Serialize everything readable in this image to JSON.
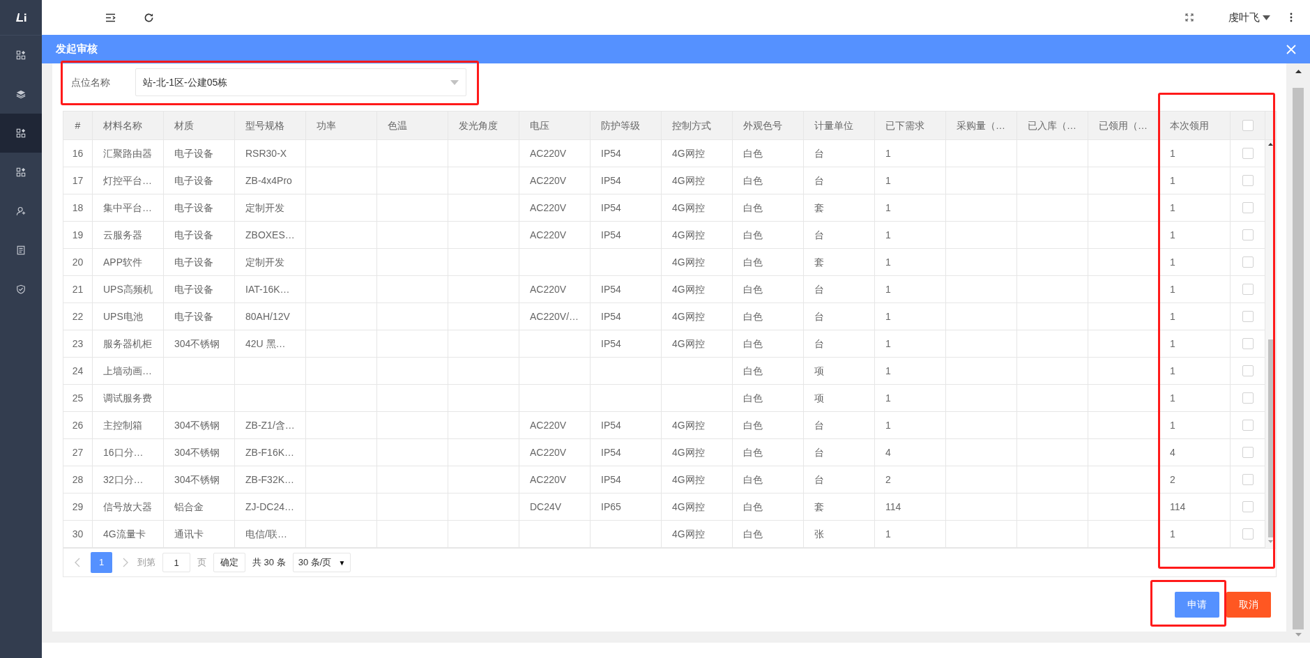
{
  "sidebar": {
    "items": [
      {
        "selected": false
      },
      {
        "selected": false
      },
      {
        "selected": true
      },
      {
        "selected": false
      },
      {
        "selected": false
      },
      {
        "selected": false
      },
      {
        "selected": false
      }
    ]
  },
  "topbar": {
    "user_name": "虔叶飞"
  },
  "dialog": {
    "title": "发起审核"
  },
  "form": {
    "label": "点位名称",
    "value": "站-北-1区-公建05栋"
  },
  "table": {
    "columns": [
      "#",
      "材料名称",
      "材质",
      "型号规格",
      "功率",
      "色温",
      "发光角度",
      "电压",
      "防护等级",
      "控制方式",
      "外观色号",
      "计量单位",
      "已下需求",
      "采购量（…",
      "已入库（…",
      "已领用（…",
      "本次领用"
    ],
    "header_checkbox": {
      "checked": false
    },
    "rows": [
      {
        "cells": [
          "16",
          "汇聚路由器",
          "电子设备",
          "RSR30-X",
          null,
          null,
          null,
          "AC220V",
          "IP54",
          "4G网控",
          "白色",
          "台",
          "1",
          null,
          null,
          null,
          "1"
        ],
        "checked": false
      },
      {
        "cells": [
          "17",
          "灯控平台…",
          "电子设备",
          "ZB-4x4Pro",
          null,
          null,
          null,
          "AC220V",
          "IP54",
          "4G网控",
          "白色",
          "台",
          "1",
          null,
          null,
          null,
          "1"
        ],
        "checked": false
      },
      {
        "cells": [
          "18",
          "集中平台…",
          "电子设备",
          "定制开发",
          null,
          null,
          null,
          "AC220V",
          "IP54",
          "4G网控",
          "白色",
          "套",
          "1",
          null,
          null,
          null,
          "1"
        ],
        "checked": false
      },
      {
        "cells": [
          "19",
          "云服务器",
          "电子设备",
          "ZBOXES…",
          null,
          null,
          null,
          "AC220V",
          "IP54",
          "4G网控",
          "白色",
          "台",
          "1",
          null,
          null,
          null,
          "1"
        ],
        "checked": false
      },
      {
        "cells": [
          "20",
          "APP软件",
          "电子设备",
          "定制开发",
          null,
          null,
          null,
          null,
          null,
          "4G网控",
          "白色",
          "套",
          "1",
          null,
          null,
          null,
          "1"
        ],
        "checked": false
      },
      {
        "cells": [
          "21",
          "UPS高频机",
          "电子设备",
          "IAT-16K…",
          null,
          null,
          null,
          "AC220V",
          "IP54",
          "4G网控",
          "白色",
          "台",
          "1",
          null,
          null,
          null,
          "1"
        ],
        "checked": false
      },
      {
        "cells": [
          "22",
          "UPS电池",
          "电子设备",
          "80AH/12V",
          null,
          null,
          null,
          "AC220V/…",
          "IP54",
          "4G网控",
          "白色",
          "台",
          "1",
          null,
          null,
          null,
          "1"
        ],
        "checked": false
      },
      {
        "cells": [
          "23",
          "服务器机柜",
          "304不锈钢",
          "42U 黑…",
          null,
          null,
          null,
          null,
          "IP54",
          "4G网控",
          "白色",
          "台",
          "1",
          null,
          null,
          null,
          "1"
        ],
        "checked": false
      },
      {
        "cells": [
          "24",
          "上墙动画…",
          null,
          null,
          null,
          null,
          null,
          null,
          null,
          null,
          "白色",
          "项",
          "1",
          null,
          null,
          null,
          "1"
        ],
        "checked": false
      },
      {
        "cells": [
          "25",
          "调试服务费",
          null,
          null,
          null,
          null,
          null,
          null,
          null,
          null,
          "白色",
          "项",
          "1",
          null,
          null,
          null,
          "1"
        ],
        "checked": false
      },
      {
        "cells": [
          "26",
          "主控制箱",
          "304不锈钢",
          "ZB-Z1/含…",
          null,
          null,
          null,
          "AC220V",
          "IP54",
          "4G网控",
          "白色",
          "台",
          "1",
          null,
          null,
          null,
          "1"
        ],
        "checked": false
      },
      {
        "cells": [
          "27",
          "16口分…",
          "304不锈钢",
          "ZB-F16K…",
          null,
          null,
          null,
          "AC220V",
          "IP54",
          "4G网控",
          "白色",
          "台",
          "4",
          null,
          null,
          null,
          "4"
        ],
        "checked": false
      },
      {
        "cells": [
          "28",
          "32口分…",
          "304不锈钢",
          "ZB-F32K…",
          null,
          null,
          null,
          "AC220V",
          "IP54",
          "4G网控",
          "白色",
          "台",
          "2",
          null,
          null,
          null,
          "2"
        ],
        "checked": false
      },
      {
        "cells": [
          "29",
          "信号放大器",
          "铝合金",
          "ZJ-DC24…",
          null,
          null,
          null,
          "DC24V",
          "IP65",
          "4G网控",
          "白色",
          "套",
          "114",
          null,
          null,
          null,
          "114"
        ],
        "checked": false
      },
      {
        "cells": [
          "30",
          "4G流量卡",
          "通讯卡",
          "电信/联…",
          null,
          null,
          null,
          null,
          null,
          "4G网控",
          "白色",
          "张",
          "1",
          null,
          null,
          null,
          "1"
        ],
        "checked": false
      }
    ]
  },
  "pagination": {
    "pages": [
      {
        "label": "1",
        "selected": true
      }
    ],
    "goto_label": "到第",
    "goto_value": "1",
    "page_suffix": "页",
    "confirm": "确定",
    "total": "共 30 条",
    "page_size": "30 条/页",
    "page_size_caret": "▼"
  },
  "buttons": [
    {
      "label": "申请",
      "kind": "primary"
    },
    {
      "label": "取消",
      "kind": "danger"
    }
  ]
}
